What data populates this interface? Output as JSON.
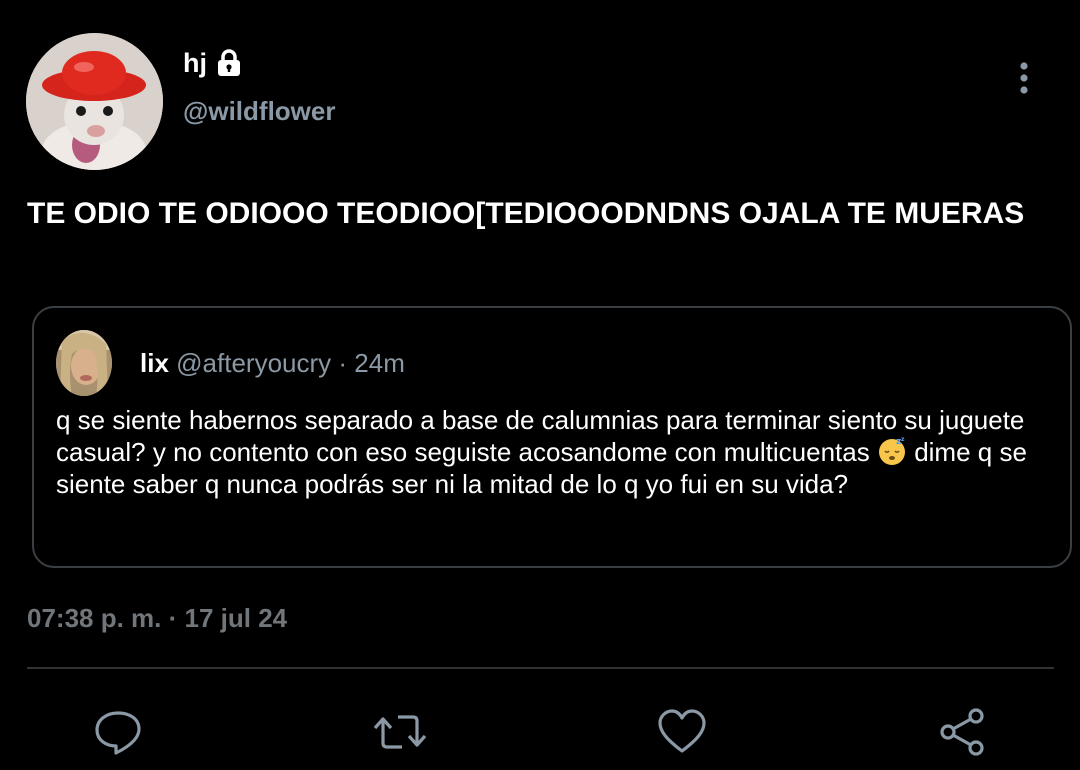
{
  "author": {
    "display_name": "hj",
    "handle": "@wildflower",
    "protected_icon": "lock-icon",
    "avatar": "avatar-rat-red-hat"
  },
  "tweet": {
    "text": "TE ODIO TE ODIOOO TEODIOO[TEDIOOODNDNS OJALA TE MUERAS",
    "timestamp": "07:38 p. m. · 17 jul 24"
  },
  "quoted_tweet": {
    "display_name": "lix",
    "handle": "@afteryoucry",
    "separator": "·",
    "time_ago": "24m",
    "text_before_emoji": "q se siente habernos separado a base de calumnias para terminar siento su juguete casual? y no contento con eso seguiste acosandome con multicuentas ",
    "emoji": "sleeping-face-emoji",
    "text_after_emoji": " dime q se siente saber q nunca podrás ser ni la mitad de lo q yo fui en su vida?"
  },
  "actions": {
    "reply_icon": "reply-icon",
    "retweet_icon": "retweet-icon",
    "like_icon": "heart-icon",
    "share_icon": "share-icon",
    "more_icon": "more-vertical-icon"
  },
  "colors": {
    "background": "#000000",
    "primary_text": "#ffffff",
    "secondary_text": "#8b98a5",
    "border": "#3a3f44",
    "icon": "#8b98a5"
  }
}
